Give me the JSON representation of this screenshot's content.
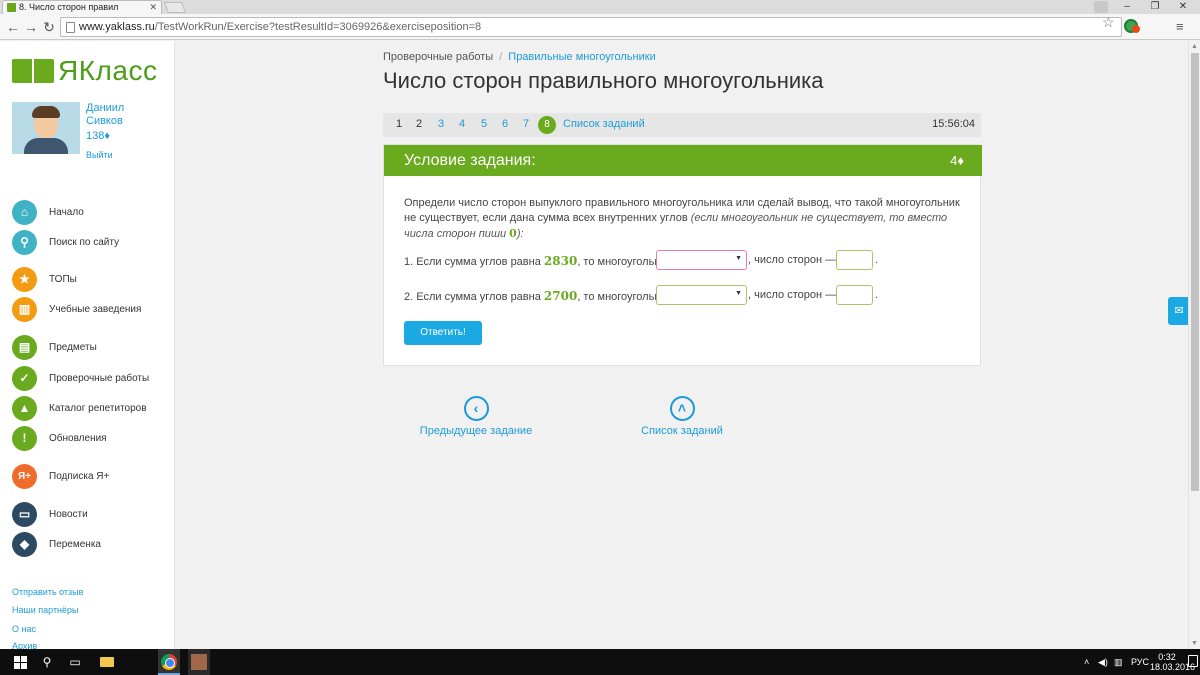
{
  "browser": {
    "tab_title": "8. Число сторон правил",
    "url_host": "www.yaklass.ru",
    "url_path": "/TestWorkRun/Exercise?testResultId=3069926&exerciseposition=8"
  },
  "sidebar": {
    "logo_text": "ЯКласс",
    "user_first": "Даниил",
    "user_last": "Сивков",
    "points": "138♦",
    "logout": "Выйти",
    "menu": [
      {
        "label": "Начало",
        "icon": "home-icon",
        "glyph": "⌂",
        "color": "#3fb3c5"
      },
      {
        "label": "Поиск по сайту",
        "icon": "search-icon",
        "glyph": "⚲",
        "color": "#3fb3c5"
      },
      {
        "label": "ТОПы",
        "icon": "star-icon",
        "glyph": "★",
        "color": "#f39c12"
      },
      {
        "label": "Учебные заведения",
        "icon": "building-icon",
        "glyph": "▥",
        "color": "#f39c12"
      },
      {
        "label": "Предметы",
        "icon": "books-icon",
        "glyph": "▤",
        "color": "#6aaa1e"
      },
      {
        "label": "Проверочные работы",
        "icon": "check-icon",
        "glyph": "✓",
        "color": "#6aaa1e"
      },
      {
        "label": "Каталог репетиторов",
        "icon": "graduation-cap-icon",
        "glyph": "▲",
        "color": "#6aaa1e"
      },
      {
        "label": "Обновления",
        "icon": "exclamation-icon",
        "glyph": "!",
        "color": "#6aaa1e"
      },
      {
        "label": "Подписка Я+",
        "icon": "ya-plus-icon",
        "glyph": "Я+",
        "color": "#ef6c2c"
      },
      {
        "label": "Новости",
        "icon": "news-icon",
        "glyph": "▭",
        "color": "#2c4a63"
      },
      {
        "label": "Переменка",
        "icon": "bell-icon",
        "glyph": "◆",
        "color": "#2c4a63"
      }
    ],
    "footer_links": [
      "Отправить отзыв",
      "Наши партнёры",
      "О нас",
      "Архив"
    ]
  },
  "breadcrumb": {
    "root": "Проверочные работы",
    "separator": "/",
    "current": "Правильные многоугольники"
  },
  "page_title": "Число сторон правильного многоугольника",
  "pager": {
    "pages": [
      "1",
      "2",
      "3",
      "4",
      "5",
      "6",
      "7"
    ],
    "current": "8",
    "list_link": "Список заданий",
    "timer": "15:56:04"
  },
  "task": {
    "header": "Условие задания:",
    "score": "4♦",
    "text_main": "Определи число сторон выпуклого правильного многоугольника или сделай вывод, что такой многоугольник не существует, если дана сумма всех внутренних углов ",
    "text_italic": "(если многоугольник не существует, то вместо числа сторон пиши ",
    "text_zero": "0",
    "text_end": "):",
    "rows": [
      {
        "prefix": "1. Если сумма углов равна ",
        "value": "2830",
        "mid": ", то многоугольник",
        "sides_label": ", число сторон —",
        "select_value": "",
        "sides_value": ""
      },
      {
        "prefix": "2. Если сумма углов равна ",
        "value": "2700",
        "mid": ", то многоугольник",
        "sides_label": ", число сторон —",
        "select_value": "",
        "sides_value": ""
      }
    ],
    "answer_button": "Ответить!"
  },
  "nav": {
    "prev_label": "Предыдущее задание",
    "list_label": "Список заданий"
  },
  "taskbar": {
    "lang": "РУС",
    "time": "0:32",
    "date": "18.03.2016"
  }
}
